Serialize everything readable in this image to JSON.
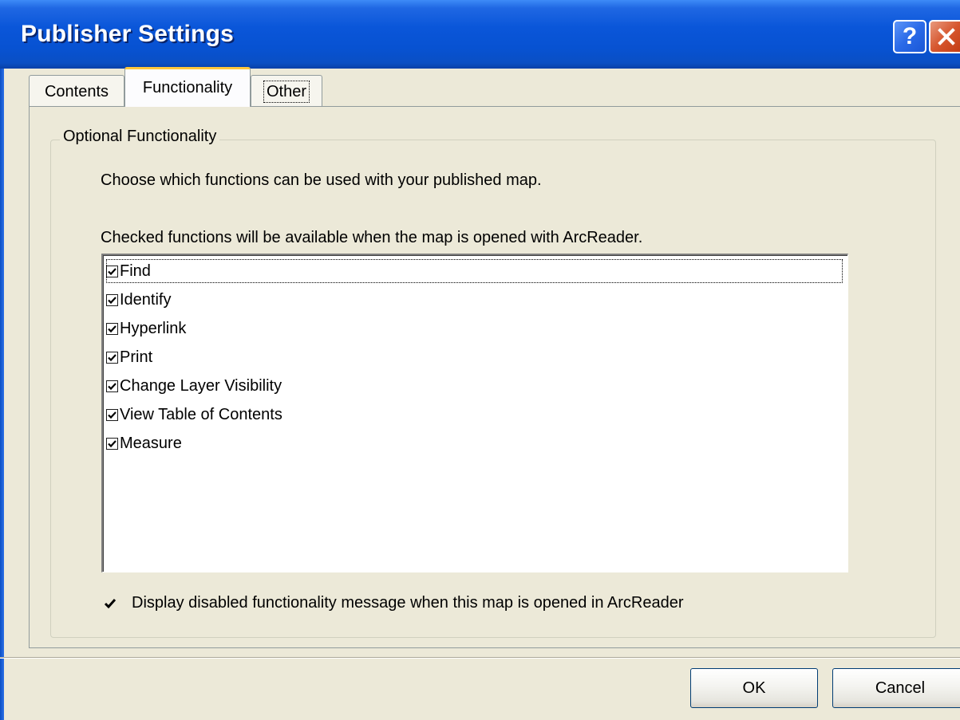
{
  "window": {
    "title": "Publisher Settings",
    "help_glyph": "?",
    "title_bar_color": "#0A56D9"
  },
  "tabs": [
    {
      "label": "Contents",
      "selected": false
    },
    {
      "label": "Functionality",
      "selected": true
    },
    {
      "label": "Other",
      "selected": false
    }
  ],
  "group": {
    "label": "Optional Functionality",
    "description": "Choose which functions can be used with your published map.",
    "list_caption": "Checked functions will be available when the map is opened with ArcReader."
  },
  "functions": [
    {
      "label": "Find",
      "checked": true
    },
    {
      "label": "Identify",
      "checked": true
    },
    {
      "label": "Hyperlink",
      "checked": true
    },
    {
      "label": "Print",
      "checked": true
    },
    {
      "label": "Change Layer Visibility",
      "checked": true
    },
    {
      "label": "View Table of Contents",
      "checked": true
    },
    {
      "label": "Measure",
      "checked": true
    }
  ],
  "display_message": {
    "label": "Display disabled functionality message when this map is opened in ArcReader",
    "checked": true
  },
  "buttons": {
    "ok": "OK",
    "cancel": "Cancel"
  },
  "icons": {
    "help": "help-icon",
    "close": "close-icon",
    "check": "checkmark-icon"
  }
}
